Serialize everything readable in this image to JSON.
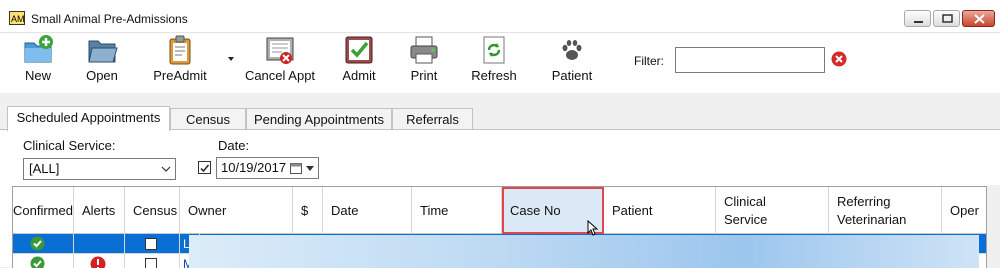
{
  "window": {
    "title": "Small Animal Pre-Admissions"
  },
  "toolbar": {
    "buttons": [
      {
        "label": "New",
        "icon": "new-folder-icon"
      },
      {
        "label": "Open",
        "icon": "open-folder-icon"
      },
      {
        "label": "PreAdmit",
        "icon": "clipboard-icon"
      },
      {
        "label": "Cancel Appt",
        "icon": "cancel-appointment-icon"
      },
      {
        "label": "Admit",
        "icon": "admit-check-icon"
      },
      {
        "label": "Print",
        "icon": "printer-icon"
      },
      {
        "label": "Refresh",
        "icon": "refresh-icon"
      },
      {
        "label": "Patient",
        "icon": "paw-icon"
      }
    ],
    "filter_label": "Filter:",
    "filter_value": ""
  },
  "tabs": [
    {
      "label": "Scheduled Appointments",
      "active": true
    },
    {
      "label": "Census",
      "active": false
    },
    {
      "label": "Pending Appointments",
      "active": false
    },
    {
      "label": "Referrals",
      "active": false
    }
  ],
  "filters": {
    "clinical_service_label": "Clinical Service:",
    "clinical_service_value": "[ALL]",
    "date_label": "Date:",
    "date_checked": true,
    "date_value": "10/19/2017"
  },
  "grid": {
    "columns": [
      "Confirmed",
      "Alerts",
      "Census",
      "Owner",
      "$",
      "Date",
      "Time",
      "Case No",
      "Patient",
      "Clinical Service",
      "Referring Veterinarian",
      "Oper"
    ],
    "highlighted_column": "Case No",
    "rows": [
      {
        "confirmed": true,
        "alert": false,
        "census": false,
        "owner_initial": "L",
        "selected": true
      },
      {
        "confirmed": true,
        "alert": true,
        "census": false,
        "owner_initial": "M",
        "selected": false
      }
    ]
  },
  "colors": {
    "selection": "#0a6fd4",
    "highlight_border": "#e0474c",
    "confirmed_green": "#3a9a3a",
    "alert_red": "#d32020"
  }
}
